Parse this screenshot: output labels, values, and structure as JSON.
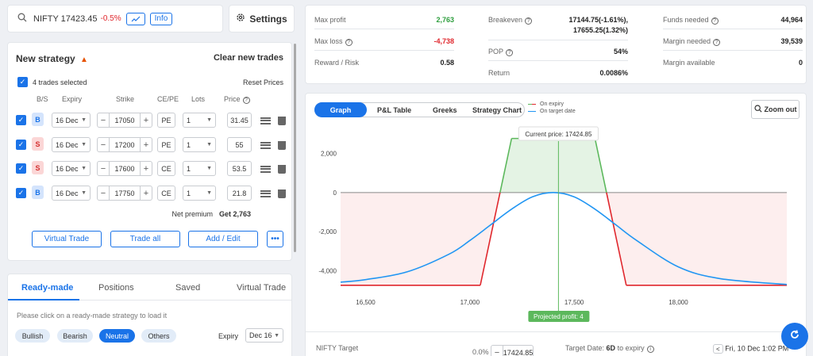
{
  "search": {
    "text": "NIFTY 17423.45",
    "change": "-0.5%",
    "info_label": "Info"
  },
  "settings": {
    "label": "Settings"
  },
  "strategy": {
    "title": "New strategy",
    "clear_label": "Clear new trades",
    "selected_text": "4 trades selected",
    "reset_label": "Reset Prices",
    "headers": {
      "bs": "B/S",
      "expiry": "Expiry",
      "strike": "Strike",
      "cepe": "CE/PE",
      "lots": "Lots",
      "price": "Price"
    },
    "trades": [
      {
        "bs": "B",
        "expiry": "16 Dec",
        "strike": "17050",
        "type": "PE",
        "lots": "1",
        "price": "31.45"
      },
      {
        "bs": "S",
        "expiry": "16 Dec",
        "strike": "17200",
        "type": "PE",
        "lots": "1",
        "price": "55"
      },
      {
        "bs": "S",
        "expiry": "16 Dec",
        "strike": "17600",
        "type": "CE",
        "lots": "1",
        "price": "53.5"
      },
      {
        "bs": "B",
        "expiry": "16 Dec",
        "strike": "17750",
        "type": "CE",
        "lots": "1",
        "price": "21.8"
      }
    ],
    "net_premium_label": "Net premium",
    "net_premium_value": "Get 2,763",
    "buttons": {
      "virtual": "Virtual Trade",
      "trade_all": "Trade all",
      "add_edit": "Add / Edit",
      "more": "•••"
    }
  },
  "ready": {
    "tabs": [
      "Ready-made",
      "Positions",
      "Saved",
      "Virtual Trade"
    ],
    "hint": "Please click on a ready-made strategy to load it",
    "filters": [
      "Bullish",
      "Bearish",
      "Neutral",
      "Others"
    ],
    "expiry_label": "Expiry",
    "expiry_value": "Dec 16"
  },
  "summary": {
    "max_profit_label": "Max profit",
    "max_profit": "2,763",
    "max_loss_label": "Max loss",
    "max_loss": "-4,738",
    "reward_risk_label": "Reward / Risk",
    "reward_risk": "0.58",
    "breakeven_label": "Breakeven",
    "breakeven_1": "17144.75(-1.61%),",
    "breakeven_2": "17655.25(1.32%)",
    "pop_label": "POP",
    "pop": "54%",
    "return_label": "Return",
    "return": "0.0086%",
    "funds_label": "Funds needed",
    "funds": "44,964",
    "margin_label": "Margin needed",
    "margin": "39,539",
    "margin_avail_label": "Margin available",
    "margin_avail": "0"
  },
  "graph": {
    "tabs": [
      "Graph",
      "P&L Table",
      "Greeks",
      "Strategy Chart"
    ],
    "legend": [
      "On expiry",
      "On target date"
    ],
    "zoom_label": "Zoom out",
    "current_price": "Current price: 17424.85",
    "projected_profit": "Projected profit: 4",
    "colors": {
      "expiry_profit": "#5cb85c",
      "expiry_loss": "#e0272d",
      "target": "#2196f3"
    },
    "footer": {
      "target_label": "NIFTY Target",
      "target_pct": "0.0%",
      "target_value": "17424.85",
      "date_label": "Target Date:",
      "date_days": "6D",
      "date_suffix": "to expiry",
      "date_value": "Fri, 10 Dec 1:02 PM"
    }
  },
  "chart_data": {
    "type": "line",
    "xlim": [
      16380,
      18520
    ],
    "ylim": [
      -4950,
      2950
    ],
    "x_ticks": [
      16500,
      17000,
      17500,
      18000
    ],
    "x_tick_labels": [
      "16,500",
      "17,000",
      "17,500",
      "18,000"
    ],
    "y_ticks": [
      2000,
      0,
      -2000,
      -4000
    ],
    "y_tick_labels": [
      "2,000",
      "0",
      "-2,000",
      "-4,000"
    ],
    "current_price": 17424.85,
    "series": [
      {
        "name": "On expiry",
        "x": [
          16380,
          17050,
          17200,
          17600,
          17750,
          18520
        ],
        "y": [
          -4738,
          -4738,
          2763,
          2763,
          -4738,
          -4738
        ]
      },
      {
        "name": "On target date",
        "x": [
          16380,
          16500,
          16700,
          16900,
          17000,
          17100,
          17200,
          17300,
          17400,
          17500,
          17600,
          17700,
          17800,
          18000,
          18200,
          18520
        ],
        "y": [
          -4580,
          -4450,
          -4050,
          -3150,
          -2450,
          -1650,
          -850,
          -220,
          0,
          -220,
          -850,
          -1650,
          -2450,
          -3800,
          -4400,
          -4700
        ]
      }
    ]
  }
}
